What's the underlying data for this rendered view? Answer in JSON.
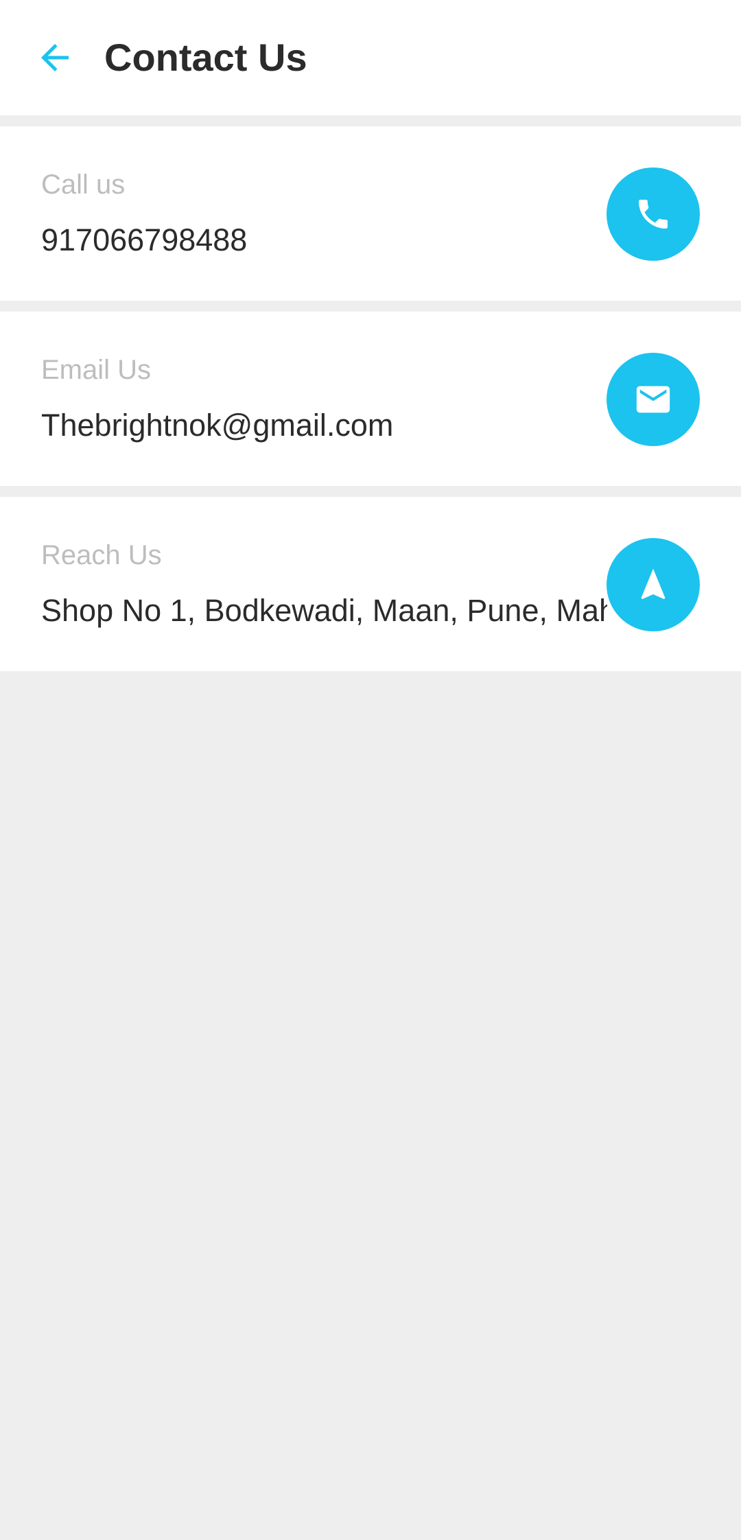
{
  "header": {
    "title": "Contact Us",
    "back_icon": "arrow-left-icon"
  },
  "contacts": [
    {
      "label": "Call us",
      "value": "917066798488",
      "action_icon": "phone-icon"
    },
    {
      "label": "Email Us",
      "value": "Thebrightnok@gmail.com",
      "action_icon": "mail-icon"
    },
    {
      "label": "Reach Us",
      "value": "Shop No 1, Bodkewadi, Maan, Pune, Mah",
      "action_icon": "navigation-icon"
    }
  ],
  "colors": {
    "accent": "#1bc3ee",
    "text_primary": "#2b2b2b",
    "text_secondary": "#bdbdbd",
    "background": "#eeeeee",
    "surface": "#ffffff"
  }
}
